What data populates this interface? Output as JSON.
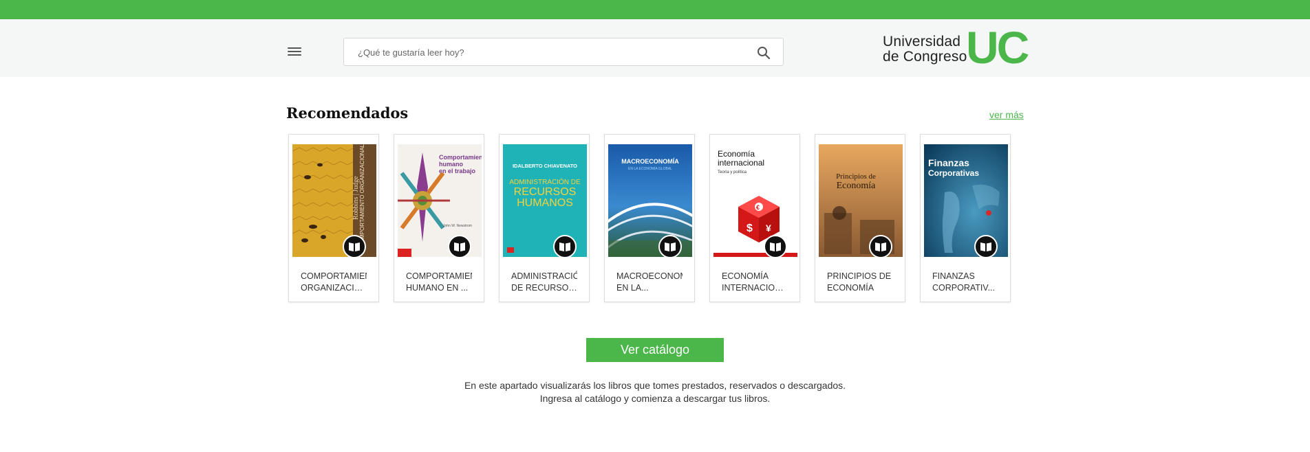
{
  "header": {
    "search_placeholder": "¿Qué te gustaría leer hoy?",
    "logo_line1": "Universidad",
    "logo_line2": "de Congreso",
    "logo_mark": "UC"
  },
  "section": {
    "title": "Recomendados",
    "see_more": "ver más"
  },
  "books": [
    {
      "line1": "COMPORTAMIENTO",
      "line2": "ORGANIZACIONAL"
    },
    {
      "line1": "COMPORTAMIENTO",
      "line2": "HUMANO EN ..."
    },
    {
      "line1": "ADMINISTRACIÓN",
      "line2": "DE RECURSOS..."
    },
    {
      "line1": "MACROECONOMÍA",
      "line2": "EN LA..."
    },
    {
      "line1": "ECONOMÍA",
      "line2": "INTERNACIONAL"
    },
    {
      "line1": "PRINCIPIOS DE",
      "line2": "ECONOMÍA"
    },
    {
      "line1": "FINANZAS",
      "line2": "CORPORATIV..."
    }
  ],
  "covers": [
    {
      "text": [
        "Robbins | Judge",
        "COMPORTAMIENTO ORGANIZACIONAL"
      ]
    },
    {
      "text": [
        "Comportamiento",
        "humano",
        "en el trabajo",
        "John W. Newstrom"
      ]
    },
    {
      "text": [
        "IDALBERTO CHIAVENATO",
        "ADMINISTRACIÓN DE",
        "RECURSOS",
        "HUMANOS"
      ]
    },
    {
      "text": [
        "MACROECONOMÍA",
        "EN LA ECONOMÍA GLOBAL"
      ]
    },
    {
      "text": [
        "Economía",
        "internacional",
        "Teoría y política"
      ]
    },
    {
      "text": [
        "Principios de",
        "Economía"
      ]
    },
    {
      "text": [
        "Finanzas",
        "Corporativas"
      ]
    }
  ],
  "cta": {
    "catalog": "Ver catálogo"
  },
  "info_text": "En este apartado visualizarás los libros que tomes prestados, reservados o descargados. Ingresa al catálogo y comienza a descargar tus libros.",
  "colors": {
    "brand_green": "#4bb74a"
  }
}
